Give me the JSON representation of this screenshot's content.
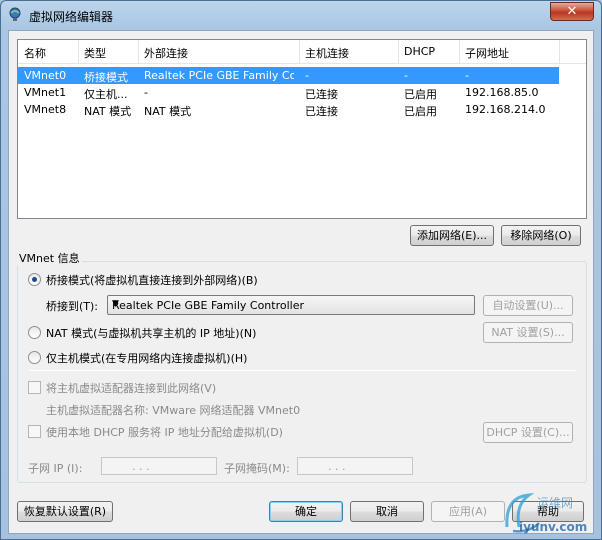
{
  "window": {
    "title": "虚拟网络编辑器",
    "close": "✕"
  },
  "table": {
    "columns": [
      "名称",
      "类型",
      "外部连接",
      "主机连接",
      "DHCP",
      "子网地址"
    ],
    "rows": [
      {
        "name": "VMnet0",
        "type": "桥接模式",
        "external": "Realtek PCIe GBE Family Co...",
        "host": "-",
        "dhcp": "-",
        "subnet": "-",
        "selected": true
      },
      {
        "name": "VMnet1",
        "type": "仅主机...",
        "external": "-",
        "host": "已连接",
        "dhcp": "已启用",
        "subnet": "192.168.85.0",
        "selected": false
      },
      {
        "name": "VMnet8",
        "type": "NAT 模式",
        "external": "NAT 模式",
        "host": "已连接",
        "dhcp": "已启用",
        "subnet": "192.168.214.0",
        "selected": false
      }
    ]
  },
  "buttons": {
    "add_network": "添加网络(E)...",
    "remove_network": "移除网络(O)",
    "auto_settings": "自动设置(U)...",
    "nat_settings": "NAT 设置(S)...",
    "dhcp_settings": "DHCP 设置(C)...",
    "restore_defaults": "恢复默认设置(R)",
    "ok": "确定",
    "cancel": "取消",
    "apply": "应用(A)",
    "help": "帮助"
  },
  "vmnet_info": {
    "title": "VMnet 信息",
    "bridged_label": "桥接模式(将虚拟机直接连接到外部网络)(B)",
    "bridged_to_label": "桥接到(T):",
    "bridged_to_value": "Realtek PCIe GBE Family Controller",
    "nat_label": "NAT 模式(与虚拟机共享主机的 IP 地址)(N)",
    "hostonly_label": "仅主机模式(在专用网络内连接虚拟机)(H)",
    "connect_adapter_label": "将主机虚拟适配器连接到此网络(V)",
    "adapter_name_label": "主机虚拟适配器名称: VMware 网络适配器 VMnet0",
    "use_dhcp_label": "使用本地 DHCP 服务将 IP 地址分配给虚拟机(D)",
    "subnet_ip_label": "子网 IP (I):",
    "subnet_mask_label": "子网掩码(M):",
    "ip_dots": ".      .      .",
    "selected_mode": "bridged"
  },
  "watermark": {
    "text1": "运维网",
    "text2": "iyunv.com"
  },
  "colors": {
    "selection": "#3399ff",
    "title_bar": "#aac6e2",
    "client_bg": "#f0f0f0"
  }
}
